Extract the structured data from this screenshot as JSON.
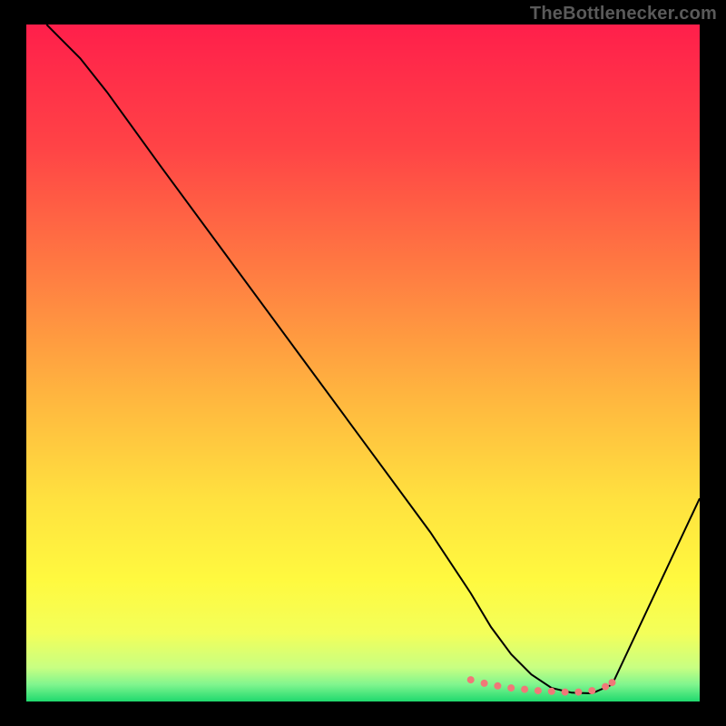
{
  "watermark": "TheBottlenecker.com",
  "chart_data": {
    "type": "line",
    "title": "",
    "xlabel": "",
    "ylabel": "",
    "xlim": [
      0,
      100
    ],
    "ylim": [
      0,
      100
    ],
    "grid": false,
    "legend": false,
    "background_gradient": {
      "stops": [
        {
          "offset": 0.0,
          "color": "#ff1f4b"
        },
        {
          "offset": 0.18,
          "color": "#ff4346"
        },
        {
          "offset": 0.36,
          "color": "#ff7a42"
        },
        {
          "offset": 0.55,
          "color": "#ffb63f"
        },
        {
          "offset": 0.7,
          "color": "#ffe13f"
        },
        {
          "offset": 0.82,
          "color": "#fff93f"
        },
        {
          "offset": 0.9,
          "color": "#f3ff5a"
        },
        {
          "offset": 0.95,
          "color": "#c8ff82"
        },
        {
          "offset": 0.975,
          "color": "#80f58e"
        },
        {
          "offset": 1.0,
          "color": "#1fd96e"
        }
      ]
    },
    "series": [
      {
        "name": "bottleneck-curve",
        "color": "#000000",
        "width": 2,
        "x": [
          3,
          5,
          8,
          12,
          20,
          30,
          40,
          50,
          60,
          66,
          69,
          72,
          75,
          78,
          81,
          84,
          87,
          100
        ],
        "y": [
          100,
          98,
          95,
          90,
          79,
          65.5,
          52,
          38.5,
          25,
          16,
          11,
          7,
          4,
          2,
          1.3,
          1.2,
          2.5,
          30
        ]
      }
    ],
    "markers": {
      "name": "optimal-range",
      "color": "#f07878",
      "radius": 4,
      "x": [
        66,
        68,
        70,
        72,
        74,
        76,
        78,
        80,
        82,
        84,
        86,
        87
      ],
      "y": [
        3.2,
        2.7,
        2.3,
        2.0,
        1.8,
        1.6,
        1.5,
        1.4,
        1.4,
        1.6,
        2.2,
        2.8
      ]
    }
  }
}
